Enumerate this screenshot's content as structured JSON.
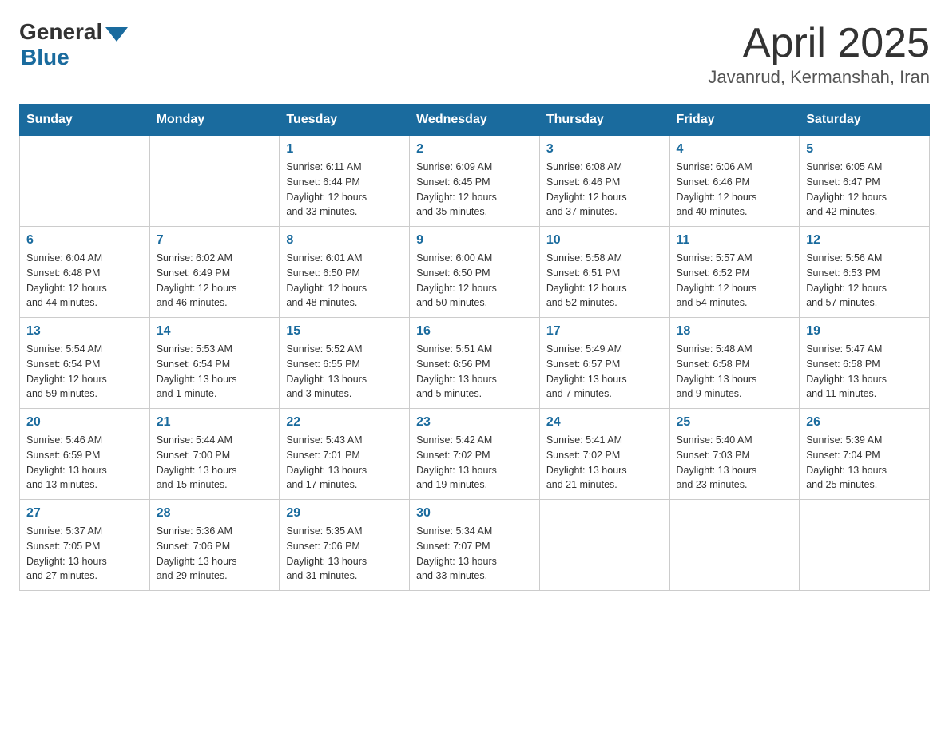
{
  "header": {
    "logo_general": "General",
    "logo_blue": "Blue",
    "month_title": "April 2025",
    "location": "Javanrud, Kermanshah, Iran"
  },
  "weekdays": [
    "Sunday",
    "Monday",
    "Tuesday",
    "Wednesday",
    "Thursday",
    "Friday",
    "Saturday"
  ],
  "weeks": [
    [
      {
        "day": "",
        "info": ""
      },
      {
        "day": "",
        "info": ""
      },
      {
        "day": "1",
        "info": "Sunrise: 6:11 AM\nSunset: 6:44 PM\nDaylight: 12 hours\nand 33 minutes."
      },
      {
        "day": "2",
        "info": "Sunrise: 6:09 AM\nSunset: 6:45 PM\nDaylight: 12 hours\nand 35 minutes."
      },
      {
        "day": "3",
        "info": "Sunrise: 6:08 AM\nSunset: 6:46 PM\nDaylight: 12 hours\nand 37 minutes."
      },
      {
        "day": "4",
        "info": "Sunrise: 6:06 AM\nSunset: 6:46 PM\nDaylight: 12 hours\nand 40 minutes."
      },
      {
        "day": "5",
        "info": "Sunrise: 6:05 AM\nSunset: 6:47 PM\nDaylight: 12 hours\nand 42 minutes."
      }
    ],
    [
      {
        "day": "6",
        "info": "Sunrise: 6:04 AM\nSunset: 6:48 PM\nDaylight: 12 hours\nand 44 minutes."
      },
      {
        "day": "7",
        "info": "Sunrise: 6:02 AM\nSunset: 6:49 PM\nDaylight: 12 hours\nand 46 minutes."
      },
      {
        "day": "8",
        "info": "Sunrise: 6:01 AM\nSunset: 6:50 PM\nDaylight: 12 hours\nand 48 minutes."
      },
      {
        "day": "9",
        "info": "Sunrise: 6:00 AM\nSunset: 6:50 PM\nDaylight: 12 hours\nand 50 minutes."
      },
      {
        "day": "10",
        "info": "Sunrise: 5:58 AM\nSunset: 6:51 PM\nDaylight: 12 hours\nand 52 minutes."
      },
      {
        "day": "11",
        "info": "Sunrise: 5:57 AM\nSunset: 6:52 PM\nDaylight: 12 hours\nand 54 minutes."
      },
      {
        "day": "12",
        "info": "Sunrise: 5:56 AM\nSunset: 6:53 PM\nDaylight: 12 hours\nand 57 minutes."
      }
    ],
    [
      {
        "day": "13",
        "info": "Sunrise: 5:54 AM\nSunset: 6:54 PM\nDaylight: 12 hours\nand 59 minutes."
      },
      {
        "day": "14",
        "info": "Sunrise: 5:53 AM\nSunset: 6:54 PM\nDaylight: 13 hours\nand 1 minute."
      },
      {
        "day": "15",
        "info": "Sunrise: 5:52 AM\nSunset: 6:55 PM\nDaylight: 13 hours\nand 3 minutes."
      },
      {
        "day": "16",
        "info": "Sunrise: 5:51 AM\nSunset: 6:56 PM\nDaylight: 13 hours\nand 5 minutes."
      },
      {
        "day": "17",
        "info": "Sunrise: 5:49 AM\nSunset: 6:57 PM\nDaylight: 13 hours\nand 7 minutes."
      },
      {
        "day": "18",
        "info": "Sunrise: 5:48 AM\nSunset: 6:58 PM\nDaylight: 13 hours\nand 9 minutes."
      },
      {
        "day": "19",
        "info": "Sunrise: 5:47 AM\nSunset: 6:58 PM\nDaylight: 13 hours\nand 11 minutes."
      }
    ],
    [
      {
        "day": "20",
        "info": "Sunrise: 5:46 AM\nSunset: 6:59 PM\nDaylight: 13 hours\nand 13 minutes."
      },
      {
        "day": "21",
        "info": "Sunrise: 5:44 AM\nSunset: 7:00 PM\nDaylight: 13 hours\nand 15 minutes."
      },
      {
        "day": "22",
        "info": "Sunrise: 5:43 AM\nSunset: 7:01 PM\nDaylight: 13 hours\nand 17 minutes."
      },
      {
        "day": "23",
        "info": "Sunrise: 5:42 AM\nSunset: 7:02 PM\nDaylight: 13 hours\nand 19 minutes."
      },
      {
        "day": "24",
        "info": "Sunrise: 5:41 AM\nSunset: 7:02 PM\nDaylight: 13 hours\nand 21 minutes."
      },
      {
        "day": "25",
        "info": "Sunrise: 5:40 AM\nSunset: 7:03 PM\nDaylight: 13 hours\nand 23 minutes."
      },
      {
        "day": "26",
        "info": "Sunrise: 5:39 AM\nSunset: 7:04 PM\nDaylight: 13 hours\nand 25 minutes."
      }
    ],
    [
      {
        "day": "27",
        "info": "Sunrise: 5:37 AM\nSunset: 7:05 PM\nDaylight: 13 hours\nand 27 minutes."
      },
      {
        "day": "28",
        "info": "Sunrise: 5:36 AM\nSunset: 7:06 PM\nDaylight: 13 hours\nand 29 minutes."
      },
      {
        "day": "29",
        "info": "Sunrise: 5:35 AM\nSunset: 7:06 PM\nDaylight: 13 hours\nand 31 minutes."
      },
      {
        "day": "30",
        "info": "Sunrise: 5:34 AM\nSunset: 7:07 PM\nDaylight: 13 hours\nand 33 minutes."
      },
      {
        "day": "",
        "info": ""
      },
      {
        "day": "",
        "info": ""
      },
      {
        "day": "",
        "info": ""
      }
    ]
  ]
}
